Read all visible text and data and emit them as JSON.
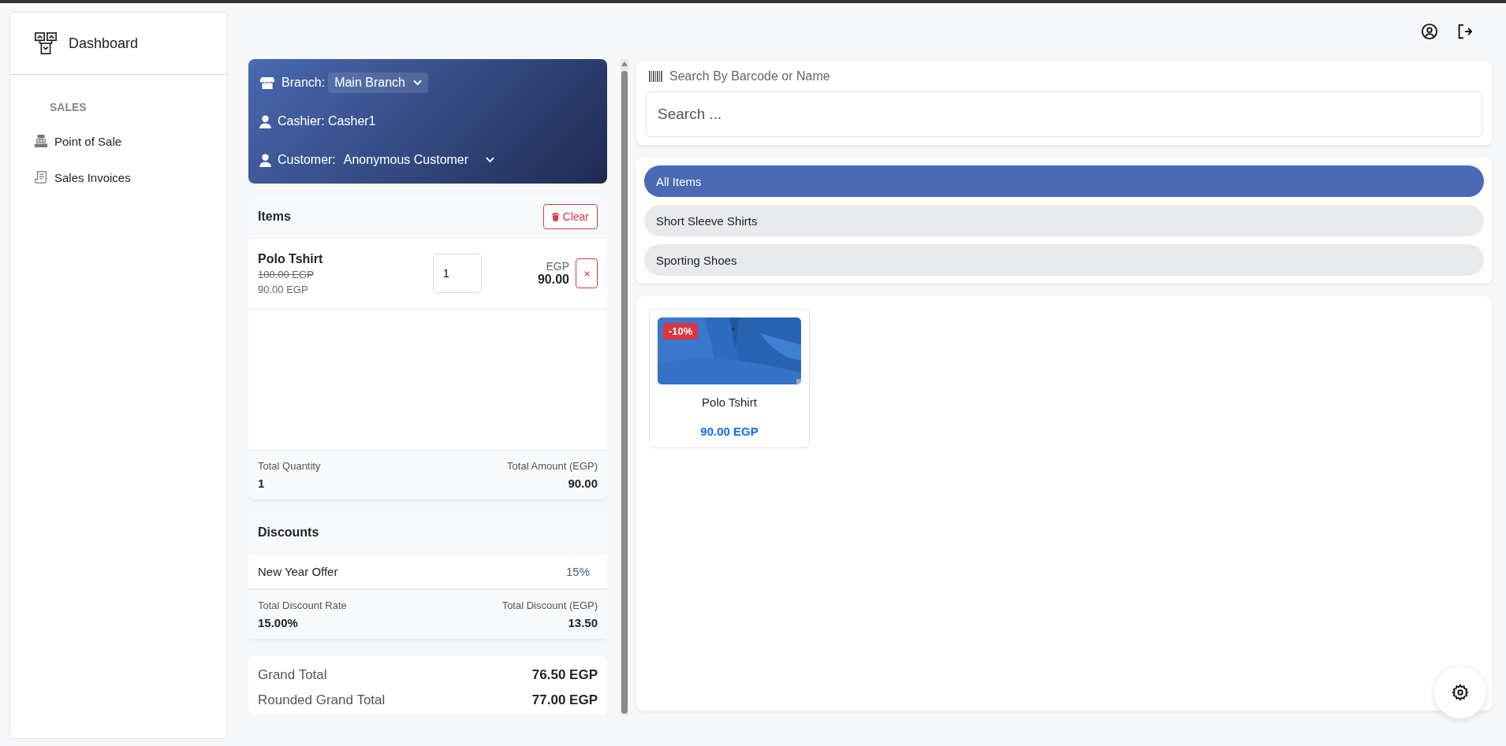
{
  "sidebar": {
    "title": "Dashboard",
    "sections": [
      {
        "heading": "SALES",
        "items": [
          {
            "label": "Point of Sale",
            "kind": "register"
          },
          {
            "label": "Sales Invoices",
            "kind": "invoice"
          }
        ]
      }
    ]
  },
  "header_card": {
    "branch_label": "Branch:",
    "branch_value": "Main Branch",
    "cashier": "Cashier: Casher1",
    "customer_label": "Customer:",
    "customer_value": "Anonymous Customer"
  },
  "items": {
    "title": "Items",
    "clear_button": "Clear",
    "rows": [
      {
        "name": "Polo Tshirt",
        "original_price": "100.00 EGP",
        "price": "90.00 EGP",
        "quantity": "1",
        "currency": "EGP",
        "total": "90.00"
      }
    ],
    "summary": [
      {
        "label": "Total Quantity",
        "value": "1"
      },
      {
        "label": "Total Amount (EGP)",
        "value": "90.00"
      }
    ]
  },
  "discounts": {
    "title": "Discounts",
    "rows": [
      {
        "name": "New Year Offer",
        "rate": "15%"
      }
    ],
    "summary": [
      {
        "label": "Total Discount Rate",
        "value": "15.00%"
      },
      {
        "label": "Total Discount (EGP)",
        "value": "13.50"
      }
    ]
  },
  "grand_totals": [
    {
      "label": "Grand Total",
      "value": "76.50 EGP"
    },
    {
      "label": "Rounded Grand Total",
      "value": "77.00 EGP"
    }
  ],
  "search": {
    "label": "Search By Barcode or Name",
    "placeholder": "Search ..."
  },
  "categories": [
    {
      "label": "All Items",
      "selected": true
    },
    {
      "label": "Short Sleeve Shirts",
      "selected": false
    },
    {
      "label": "Sporting Shoes",
      "selected": false
    }
  ],
  "products": [
    {
      "name": "Polo Tshirt",
      "price": "90.00 EGP",
      "badge": "-10%"
    }
  ]
}
